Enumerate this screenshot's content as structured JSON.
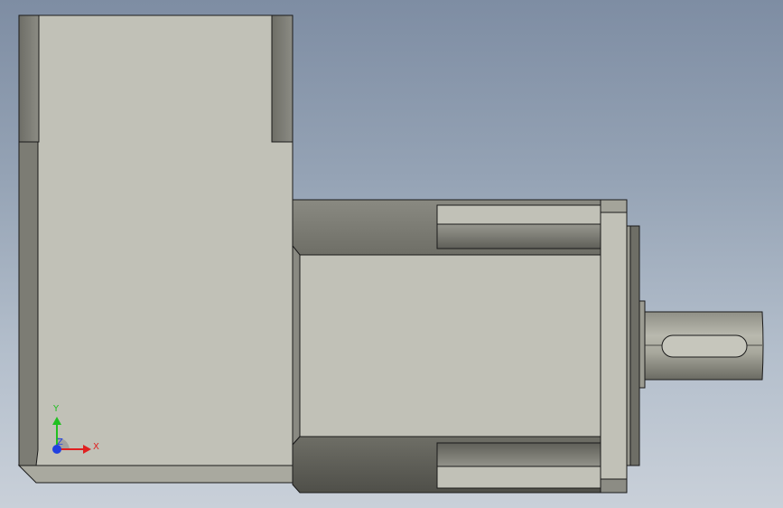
{
  "viewport": {
    "background_top": "#7e8da3",
    "background_bottom": "#c9d0d9"
  },
  "model": {
    "face_color": "#c1c1b7",
    "shadow_color": "#6b6b62",
    "edge_color": "#1a1a1a"
  },
  "triad": {
    "x_label": "X",
    "y_label": "Y",
    "z_label": "Z",
    "x_color": "#e02020",
    "y_color": "#20c020",
    "z_color": "#2040e0"
  }
}
